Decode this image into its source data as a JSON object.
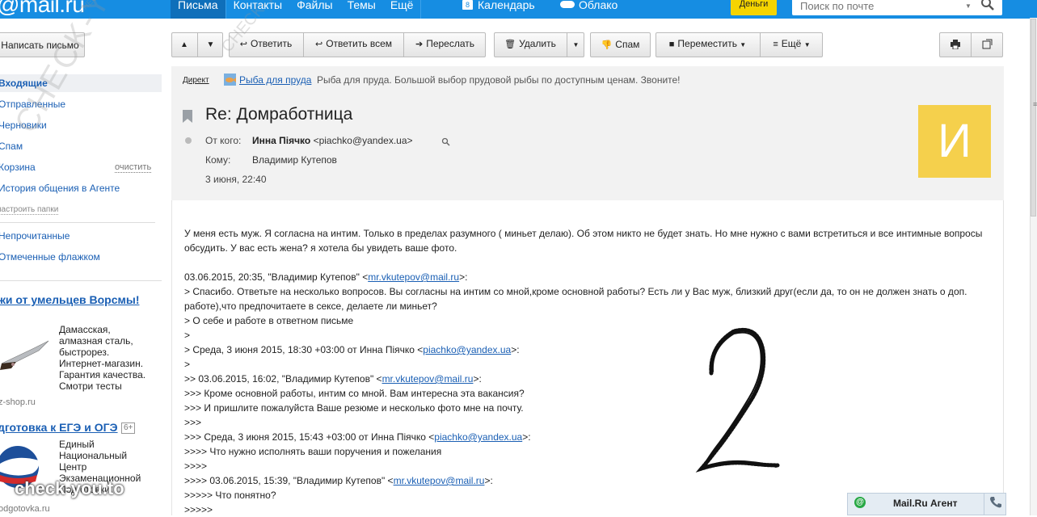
{
  "brand": {
    "logo": "@mail.ru"
  },
  "topnav": {
    "items": [
      "Письма",
      "Контакты",
      "Файлы",
      "Темы",
      "Ещё"
    ],
    "active": "Письма",
    "calendar_label": "Календарь",
    "calendar_day": "8",
    "cloud_label": "Облако",
    "money_label": "Деньги",
    "search_placeholder": "Поиск по почте"
  },
  "sidebar": {
    "compose_label": "Написать письмо",
    "folders": [
      {
        "label": "Входящие",
        "active": true
      },
      {
        "label": "Отправленные"
      },
      {
        "label": "Черновики"
      },
      {
        "label": "Спам"
      },
      {
        "label": "Корзина"
      },
      {
        "label": "История общения в Агенте"
      }
    ],
    "clean_label": "очистить",
    "setup_label": "настроить папки",
    "filters": [
      "Непрочитанные",
      "Отмеченные флажком"
    ],
    "ads": [
      {
        "title": "жи от умельцев Ворсмы!",
        "lines": [
          "Дамасская,",
          "алмазная сталь,",
          "быстрорез.",
          "Интернет-магазин.",
          "Гарантия качества.",
          "Смотри тесты"
        ],
        "site": "z-shop.ru"
      },
      {
        "title": "дготовка к ЕГЭ и ОГЭ",
        "badge": "6+",
        "lines": [
          "Единый",
          "Национальный",
          "Центр",
          "Экзаменационной",
          "Подготовки"
        ],
        "site": "odgotovka.ru"
      }
    ]
  },
  "toolbar": {
    "reply": "Ответить",
    "reply_all": "Ответить всем",
    "forward": "Переслать",
    "delete": "Удалить",
    "spam": "Спам",
    "move": "Переместить",
    "more": "Ещё"
  },
  "ad_line": {
    "label": "Директ",
    "link": "Рыба для пруда",
    "text": "Рыба для пруда. Большой выбор прудовой рыбы по доступным ценам. Звоните!"
  },
  "message": {
    "subject": "Re: Домработница",
    "from_label": "От кого:",
    "from_name": "Инна Піячко",
    "from_email": "<piachko@yandex.ua>",
    "to_label": "Кому:",
    "to_value": "Владимир Кутепов",
    "date": "3 июня, 22:40",
    "avatar_letter": "И",
    "body": {
      "p1": "У меня есть муж. Я согласна на интим. Только в пределах разумного ( миньет делаю). Об этом никто не будет знать. Но мне нужно с вами встретиться и все интимные вопросы обсудить. У вас есть жена? я хотела бы увидеть ваше фото.",
      "q1_head": "03.06.2015, 20:35, \"Владимир Кутепов\" <",
      "q1_mail": "mr.vkutepov@mail.ru",
      "q1_tail": ">:",
      "q1_text": "> Спасибо. Ответьте на несколько вопросов. Вы согласны на интим со мной,кроме основной работы? Есть ли у Вас муж, близкий друг(если да, то он не должен знать о доп. работе),что предпочитаете в сексе, делаете ли миньет?",
      "q1_l2": "> О себе и работе в ответном письме",
      "q1_l3": ">",
      "q2_head": "> Среда, 3 июня 2015, 18:30 +03:00 от Инна Піячко <",
      "q2_mail": "piachko@yandex.ua",
      "q2_tail": ">:",
      "q2_l1": ">",
      "q3_head": ">> 03.06.2015, 16:02, \"Владимир Кутепов\" <",
      "q3_mail": "mr.vkutepov@mail.ru",
      "q3_tail": ">:",
      "q3_l1": ">>> Кроме основной работы, интим со мной. Вам интересна эта вакансия?",
      "q3_l2": ">>> И пришлите пожалуйста Ваше резюме и несколько фото мне на почту.",
      "q3_l3": ">>>",
      "q4_head": ">>> Среда,  3 июня 2015, 15:43 +03:00 от Инна Піячко <",
      "q4_mail": "piachko@yandex.ua",
      "q4_tail": ">:",
      "q4_l1": ">>>>  Что нужно исполнять ваши поручения и пожелания",
      "q4_l2": ">>>>",
      "q5_head": ">>>>  03.06.2015, 15:39, \"Владимир Кутепов\" <",
      "q5_mail": "mr.vkutepov@mail.ru",
      "q5_tail": ">:",
      "q5_l1": ">>>>>  Что понятно?",
      "q5_l2": ">>>>>"
    }
  },
  "overlay": {
    "handwritten_digit": "2",
    "watermark_diagonal": "CHECK-YOU.ME",
    "watermark_bottom": "check-you.to"
  },
  "agent": {
    "label": "Mail.Ru Агент"
  },
  "colors": {
    "topbar": "#168de2",
    "money": "#f5d400",
    "avatar": "#f5d04c",
    "link": "#1a5fb4"
  }
}
